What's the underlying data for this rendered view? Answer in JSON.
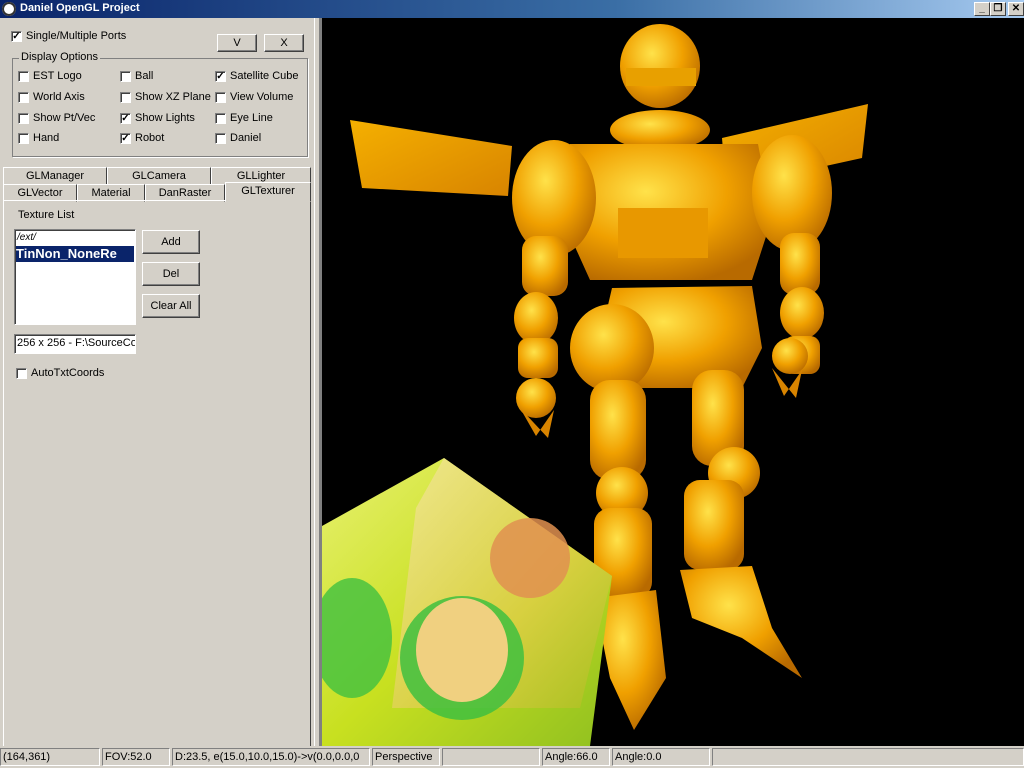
{
  "window": {
    "title": "Daniel OpenGL Project",
    "min_label": "_",
    "max_label": "❐",
    "close_label": "✕"
  },
  "top": {
    "single_multiple_ports": {
      "label": "Single/Multiple Ports",
      "checked": true
    },
    "v_button": "V",
    "x_button": "X"
  },
  "display_options": {
    "legend": "Display Options",
    "items": [
      {
        "label": "EST Logo",
        "checked": false
      },
      {
        "label": "Ball",
        "checked": false
      },
      {
        "label": "Satellite Cube",
        "checked": true
      },
      {
        "label": "World Axis",
        "checked": false
      },
      {
        "label": "Show XZ Plane",
        "checked": false
      },
      {
        "label": "View Volume",
        "checked": false
      },
      {
        "label": "Show Pt/Vec",
        "checked": false
      },
      {
        "label": "Show Lights",
        "checked": true
      },
      {
        "label": "Eye Line",
        "checked": false
      },
      {
        "label": "Hand",
        "checked": false
      },
      {
        "label": "Robot",
        "checked": true
      },
      {
        "label": "Daniel",
        "checked": false
      }
    ]
  },
  "tabs": {
    "row1": [
      "GLManager",
      "GLCamera",
      "GLLighter"
    ],
    "row2": [
      "GLVector",
      "Material",
      "DanRaster",
      "GLTexturer"
    ],
    "active": "GLTexturer"
  },
  "texturer": {
    "list_label": "Texture List",
    "list_items": [
      "/ext/",
      "TinNon_NoneRe"
    ],
    "selected_index": 1,
    "add_button": "Add",
    "del_button": "Del",
    "clear_button": "Clear All",
    "info_field": "256 x 256 - F:\\SourceCo",
    "auto_coords": {
      "label": "AutoTxtCoords",
      "checked": false
    }
  },
  "statusbar": {
    "coords": "(164,361)",
    "fov": "FOV:52.0",
    "camera": "D:23.5, e(15.0,10.0,15.0)->v(0.0,0.0,0",
    "projection": "Perspective",
    "empty1": "",
    "angle1": "Angle:66.0",
    "angle2": "Angle:0.0",
    "empty2": ""
  },
  "colors": {
    "robot": "#f0a000",
    "viewport_bg": "#000000",
    "cube": "#c8e020",
    "titlebar": "#0a246a"
  }
}
